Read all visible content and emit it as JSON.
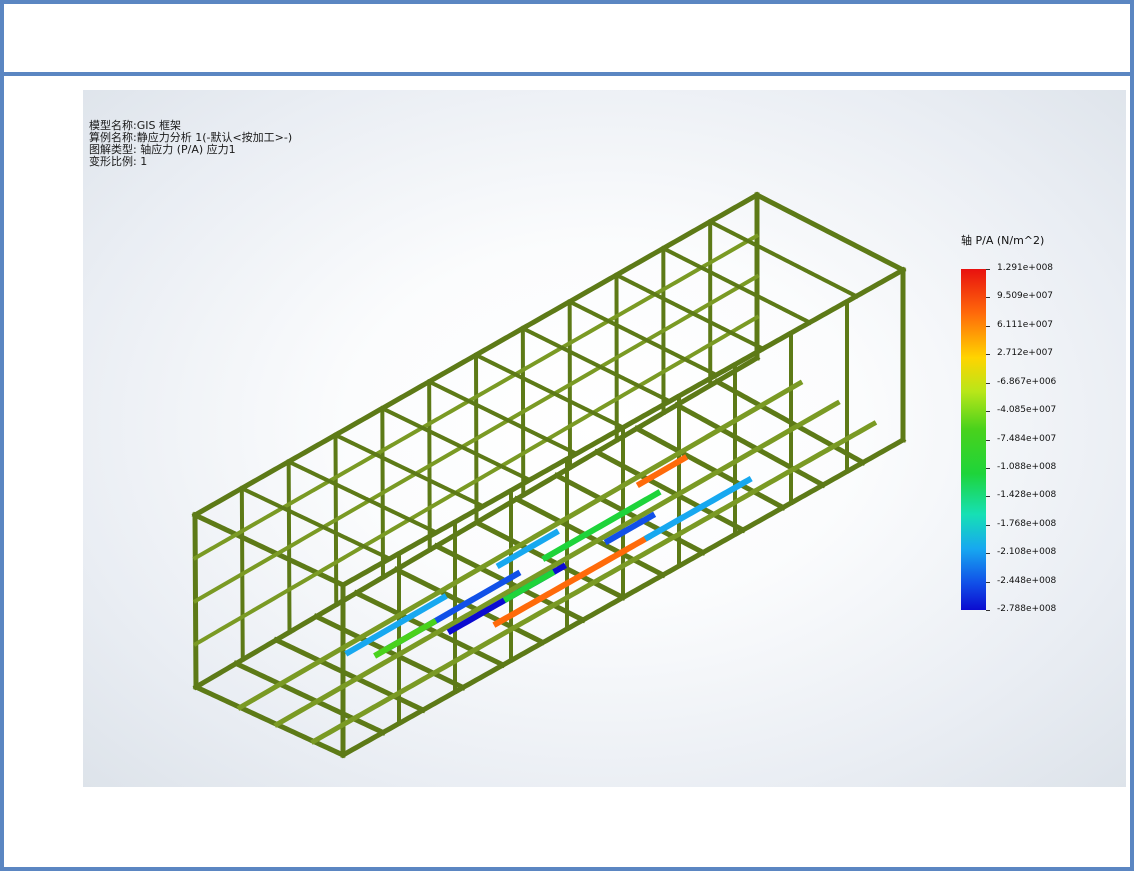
{
  "study_info": {
    "model_name": "模型名称:GIS 框架",
    "study_name": "算例名称:静应力分析 1(-默认<按加工>-)",
    "plot_type": "图解类型: 轴应力 (P/A) 应力1",
    "deformation_scale": "变形比例: 1"
  },
  "legend": {
    "title": "轴 P/A (N/m^2)",
    "values": [
      "1.291e+008",
      "9.509e+007",
      "6.111e+007",
      "2.712e+007",
      "-6.867e+006",
      "-4.085e+007",
      "-7.484e+007",
      "-1.088e+008",
      "-1.428e+008",
      "-1.768e+008",
      "-2.108e+008",
      "-2.448e+008",
      "-2.788e+008"
    ],
    "colors": [
      "#e8110f",
      "#ff6a0a",
      "#ffd400",
      "#b8e619",
      "#49d21c",
      "#1ed43a",
      "#16e0b5",
      "#17a8f0",
      "#1150e8",
      "#0b0bd0"
    ]
  },
  "model": {
    "frame_color": "#5d7a17",
    "frame_highlight": "#7a9a24",
    "stress_colors": [
      "#17a8f0",
      "#1150e8",
      "#0b0bd0",
      "#ff6a0a",
      "#1ed43a",
      "#49d21c"
    ]
  },
  "colors": {
    "panel_border": "#5b86c2"
  }
}
